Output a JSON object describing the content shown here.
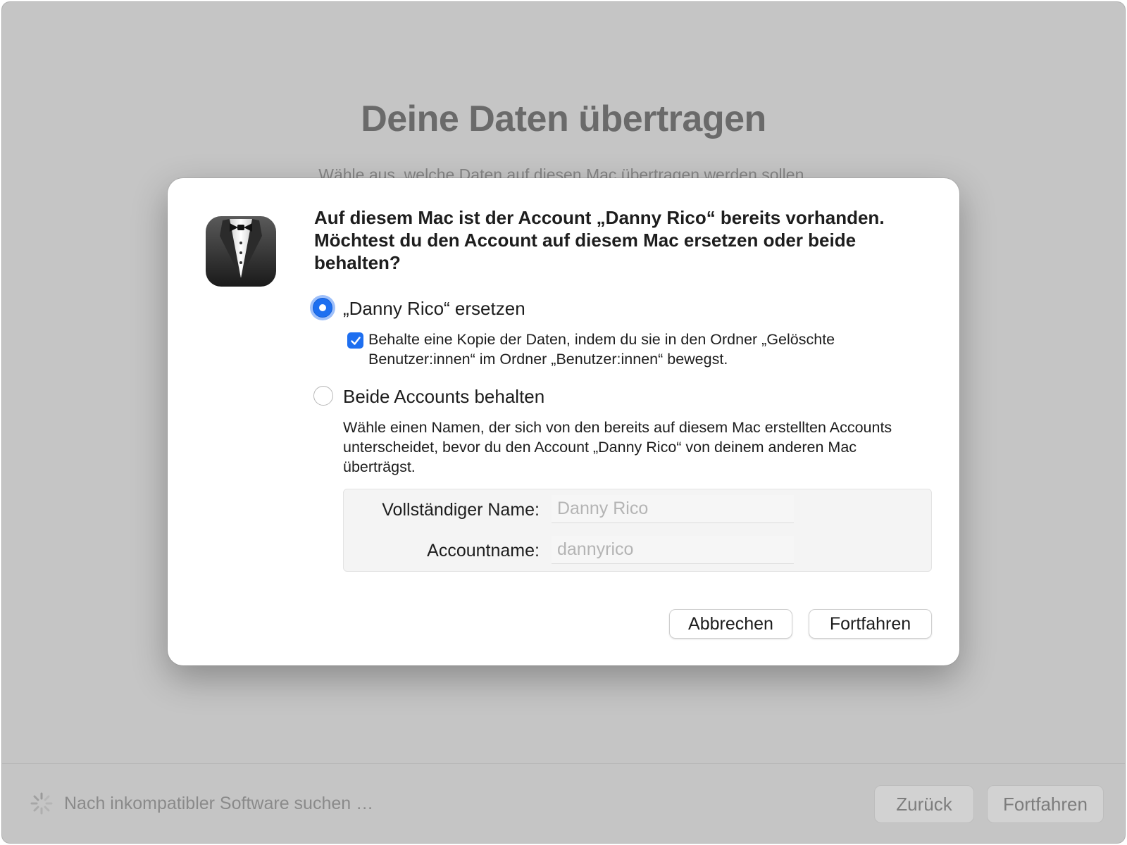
{
  "background": {
    "title": "Deine Daten übertragen",
    "subtitle": "Wähle aus, welche Daten auf diesen Mac übertragen werden sollen.",
    "status_text": "Nach inkompatibler Software suchen …",
    "back_label": "Zurück",
    "continue_label": "Fortfahren"
  },
  "dialog": {
    "icon": "tuxedo-butler-icon",
    "headline": "Auf diesem Mac ist der Account „Danny Rico“ bereits vorhanden. Möchtest du den Account auf diesem Mac ersetzen oder beide behalten?",
    "option_replace": {
      "label": "„Danny Rico“ ersetzen",
      "selected": true,
      "keep_copy_label": "Behalte eine Kopie der Daten, indem du sie in den Ordner „Gelöschte Benutzer:innen“ im Ordner „Benutzer:innen“ bewegst.",
      "keep_copy_checked": true
    },
    "option_keep_both": {
      "label": "Beide Accounts behalten",
      "selected": false,
      "description": "Wähle einen Namen, der sich von den bereits auf diesem Mac erstellten Accounts unterscheidet, bevor du den Account „Danny Rico“ von deinem anderen Mac überträgst."
    },
    "form": {
      "full_name_label": "Vollständiger Name:",
      "full_name_placeholder": "Danny Rico",
      "account_name_label": "Accountname:",
      "account_name_placeholder": "dannyrico"
    },
    "cancel_label": "Abbrechen",
    "continue_label": "Fortfahren"
  },
  "colors": {
    "accent": "#1e6ff0",
    "dim_background": "#c5c5c5",
    "dialog_background": "#ffffff"
  }
}
